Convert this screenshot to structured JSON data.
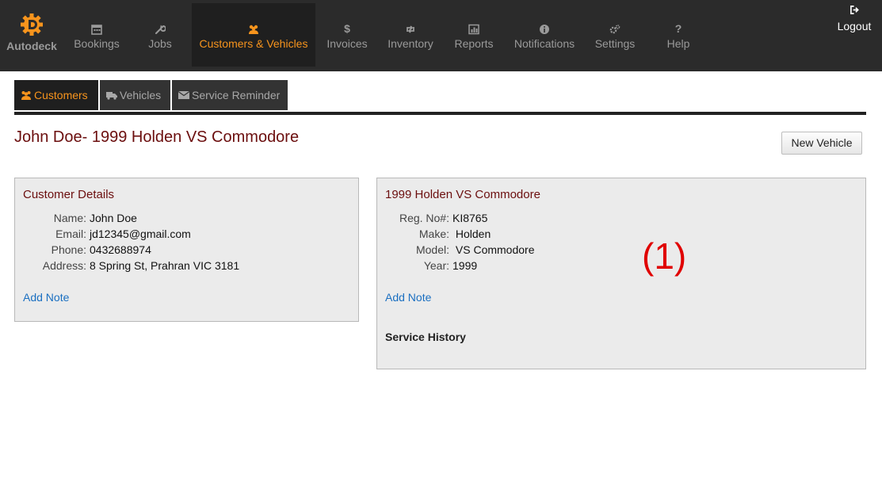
{
  "brand": {
    "name": "Autodeck"
  },
  "nav": {
    "items": [
      {
        "label": "Bookings",
        "icon": "calendar-icon"
      },
      {
        "label": "Jobs",
        "icon": "wrench-icon"
      },
      {
        "label": "Customers & Vehicles",
        "icon": "users-icon",
        "active": true
      },
      {
        "label": "Invoices",
        "icon": "dollar-icon"
      },
      {
        "label": "Inventory",
        "icon": "retweet-icon"
      },
      {
        "label": "Reports",
        "icon": "bar-chart-icon"
      },
      {
        "label": "Notifications",
        "icon": "info-icon"
      },
      {
        "label": "Settings",
        "icon": "gears-icon"
      },
      {
        "label": "Help",
        "icon": "question-icon"
      }
    ],
    "logout_label": "Logout"
  },
  "subtabs": [
    {
      "label": "Customers",
      "icon": "users-icon",
      "active": true
    },
    {
      "label": "Vehicles",
      "icon": "truck-icon"
    },
    {
      "label": "Service Reminder",
      "icon": "envelope-icon"
    }
  ],
  "page": {
    "title": "John Doe- 1999 Holden VS Commodore",
    "new_vehicle_label": "New Vehicle"
  },
  "customer_panel": {
    "title": "Customer Details",
    "fields": [
      {
        "label": "Name:",
        "value": "John Doe"
      },
      {
        "label": "Email:",
        "value": "jd12345@gmail.com"
      },
      {
        "label": "Phone:",
        "value": "0432688974"
      },
      {
        "label": "Address:",
        "value": "8 Spring St, Prahran VIC 3181"
      }
    ],
    "add_note_label": "Add Note"
  },
  "vehicle_panel": {
    "title": "1999 Holden VS Commodore",
    "fields": [
      {
        "label": "Reg. No#:",
        "value": "KI8765"
      },
      {
        "label": "Make:",
        "value": " Holden"
      },
      {
        "label": "Model:",
        "value": " VS Commodore"
      },
      {
        "label": "Year:",
        "value": "1999"
      }
    ],
    "add_note_label": "Add Note",
    "service_history_label": "Service History"
  },
  "annotation": "(1)",
  "colors": {
    "nav_bg": "#2b2b2b",
    "accent": "#f7941d",
    "title": "#6b0e0e",
    "link": "#1a6fc1",
    "annotation": "#e00000"
  }
}
